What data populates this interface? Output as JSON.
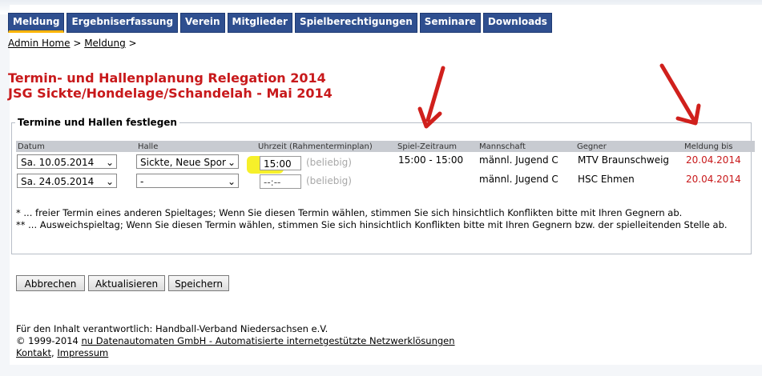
{
  "nav": {
    "tabs": [
      "Meldung",
      "Ergebniserfassung",
      "Verein",
      "Mitglieder",
      "Spielberechtigungen",
      "Seminare",
      "Downloads"
    ]
  },
  "breadcrumb": {
    "home": "Admin Home",
    "sep1": " > ",
    "current": "Meldung",
    "sep2": " >"
  },
  "title": {
    "line1": "Termin- und Hallenplanung Relegation 2014",
    "line2": "JSG Sickte/Hondelage/Schandelah - Mai 2014"
  },
  "fieldset": {
    "legend": "Termine und Hallen festlegen"
  },
  "table": {
    "headers": [
      "Datum",
      "Halle",
      "Uhrzeit (Rahmenterminplan)",
      "Spiel-Zeitraum",
      "Mannschaft",
      "Gegner",
      "Meldung bis"
    ],
    "rows": [
      {
        "datum": "Sa. 10.05.2014",
        "halle": "Sickte, Neue Spor",
        "uhrzeit": "15:00",
        "hint": "(beliebig)",
        "zeitraum": "15:00 - 15:00",
        "mannschaft": "männl. Jugend C",
        "gegner": "MTV Braunschweig",
        "meldung_bis": "20.04.2014"
      },
      {
        "datum": "Sa. 24.05.2014",
        "halle": "-",
        "uhrzeit": "--:--",
        "hint": "(beliebig)",
        "zeitraum": "",
        "mannschaft": "männl. Jugend C",
        "gegner": "HSC Ehmen",
        "meldung_bis": "20.04.2014"
      }
    ]
  },
  "notes": {
    "n1": "*   ... freier Termin eines anderen Spieltages; Wenn Sie diesen Termin wählen, stimmen Sie sich hinsichtlich Konflikten bitte mit Ihren Gegnern ab.",
    "n2": "** ... Ausweichspieltag; Wenn Sie diesen Termin wählen, stimmen Sie sich hinsichtlich Konflikten bitte mit Ihren Gegnern bzw. der spielleitenden Stelle ab."
  },
  "buttons": {
    "cancel": "Abbrechen",
    "refresh": "Aktualisieren",
    "save": "Speichern"
  },
  "footer": {
    "line1": "Für den Inhalt verantwortlich: Handball-Verband Niedersachsen e.V.",
    "copy": "© 1999-2014 ",
    "link": "nu Datenautomaten GmbH - Automatisierte internetgestützte Netzwerklösungen",
    "kontakt": "Kontakt",
    "comma": ", ",
    "impressum": "Impressum"
  },
  "colors": {
    "nav_bg": "#2f4f8f",
    "title_red": "#c8191b",
    "highlight": "#f6f02a",
    "arrow_red": "#d0201c"
  }
}
